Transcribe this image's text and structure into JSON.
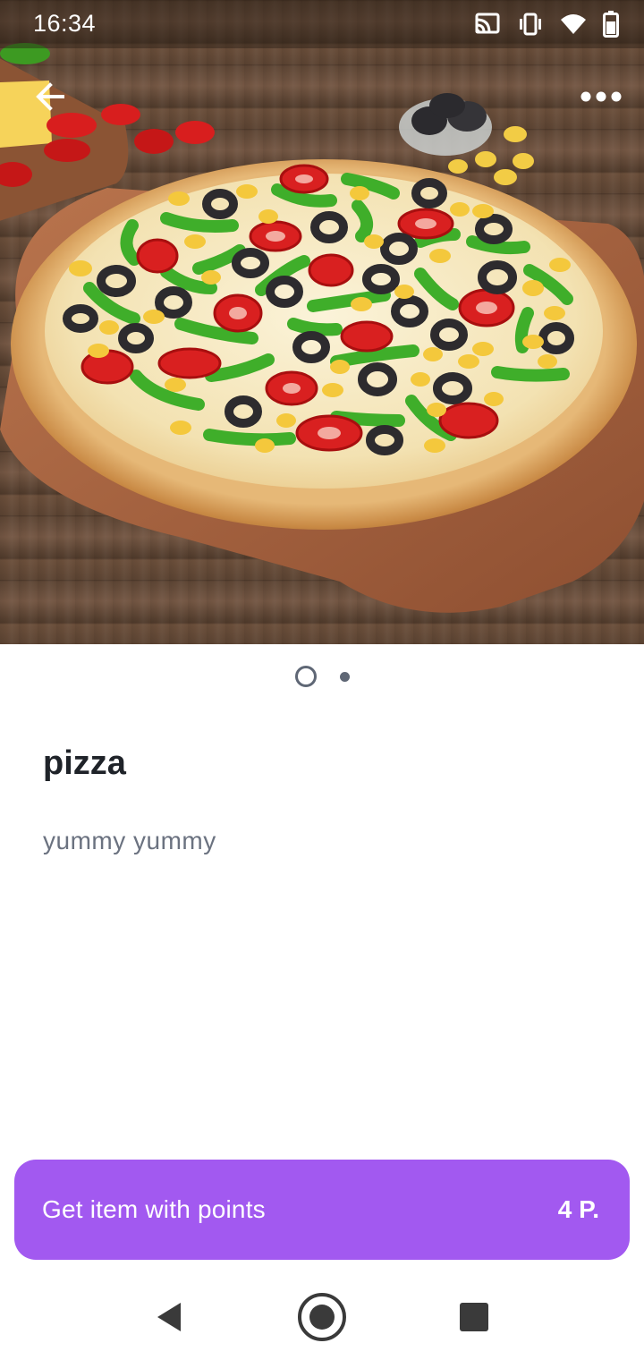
{
  "status_bar": {
    "time": "16:34",
    "icons": [
      "cast-icon",
      "vibrate-icon",
      "wifi-icon",
      "battery-icon"
    ]
  },
  "header": {
    "back_icon": "arrow-left-icon",
    "more_icon": "more-horizontal-icon"
  },
  "hero_image": {
    "subject": "pizza-photo",
    "page_count": 2,
    "current_page": 1
  },
  "item": {
    "title": "pizza",
    "description": "yummy yummy"
  },
  "cta": {
    "label": "Get item with points",
    "points": "4 P.",
    "color": "#a259f0"
  },
  "nav_bar": {
    "icons": [
      "nav-back-icon",
      "nav-home-icon",
      "nav-recents-icon"
    ]
  },
  "colors": {
    "accent": "#a259f0",
    "title_text": "#1f2329",
    "body_text": "#6b7280",
    "pager": "#5f6775"
  }
}
